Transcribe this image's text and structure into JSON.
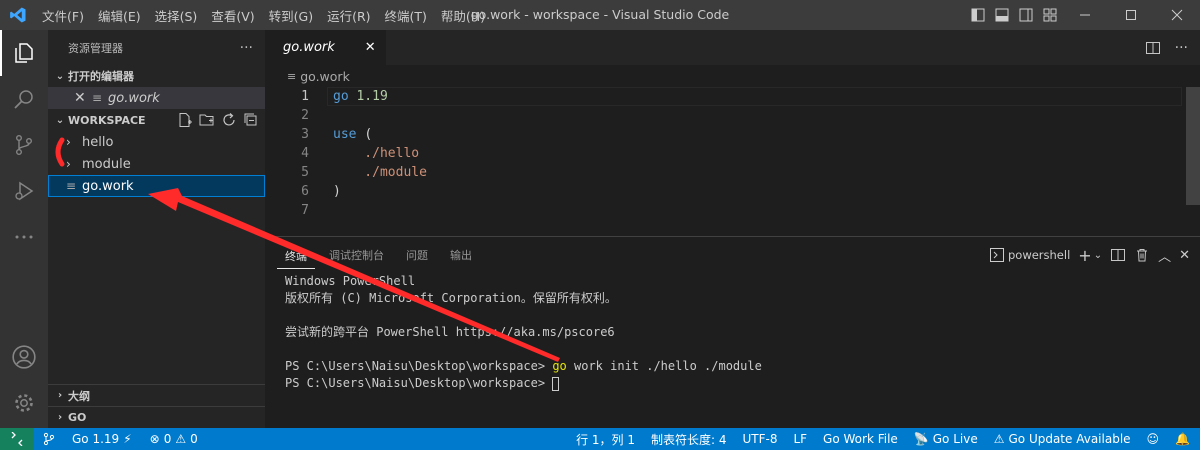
{
  "window": {
    "title": "go.work - workspace - Visual Studio Code",
    "menu": [
      "文件(F)",
      "编辑(E)",
      "选择(S)",
      "查看(V)",
      "转到(G)",
      "运行(R)",
      "终端(T)",
      "帮助(H)"
    ]
  },
  "sidebar": {
    "header": "资源管理器",
    "more": "···",
    "open_editors_title": "打开的编辑器",
    "open_editor_file": "go.work",
    "workspace_title": "WORKSPACE",
    "tree": [
      {
        "name": "hello",
        "type": "folder"
      },
      {
        "name": "module",
        "type": "folder"
      },
      {
        "name": "go.work",
        "type": "file"
      }
    ],
    "outline_title": "大纲",
    "go_title": "GO"
  },
  "editor": {
    "tab_label": "go.work",
    "breadcrumb": "go.work",
    "lines": [
      {
        "n": "1",
        "parts": [
          {
            "t": "go ",
            "c": "kw"
          },
          {
            "t": "1.19",
            "c": "num"
          }
        ]
      },
      {
        "n": "2",
        "parts": []
      },
      {
        "n": "3",
        "parts": [
          {
            "t": "use ",
            "c": "kw"
          },
          {
            "t": "(",
            "c": "punc"
          }
        ]
      },
      {
        "n": "4",
        "parts": [
          {
            "t": "    ./hello",
            "c": "str"
          }
        ]
      },
      {
        "n": "5",
        "parts": [
          {
            "t": "    ./module",
            "c": "str"
          }
        ]
      },
      {
        "n": "6",
        "parts": [
          {
            "t": ")",
            "c": "punc"
          }
        ]
      },
      {
        "n": "7",
        "parts": []
      }
    ]
  },
  "panel": {
    "tabs": [
      "终端",
      "调试控制台",
      "问题",
      "输出"
    ],
    "shell": "powershell",
    "terminal_lines": [
      "Windows PowerShell",
      "版权所有 (C) Microsoft Corporation。保留所有权利。",
      "",
      "尝试新的跨平台 PowerShell https://aka.ms/pscore6",
      ""
    ],
    "prompt": "PS C:\\Users\\Naisu\\Desktop\\workspace> ",
    "command_go": "go",
    "command_rest": " work init ./hello ./module"
  },
  "statusbar": {
    "go_version": "Go 1.19",
    "errors": "0",
    "warnings": "0",
    "position": "行 1，列 1",
    "tab_size": "制表符长度: 4",
    "encoding": "UTF-8",
    "eol": "LF",
    "language": "Go Work File",
    "go_live": "Go Live",
    "go_update": "Go Update Available"
  },
  "colors": {
    "accent": "#007acc",
    "remote": "#16825d",
    "annotation": "#ff2a2a"
  }
}
